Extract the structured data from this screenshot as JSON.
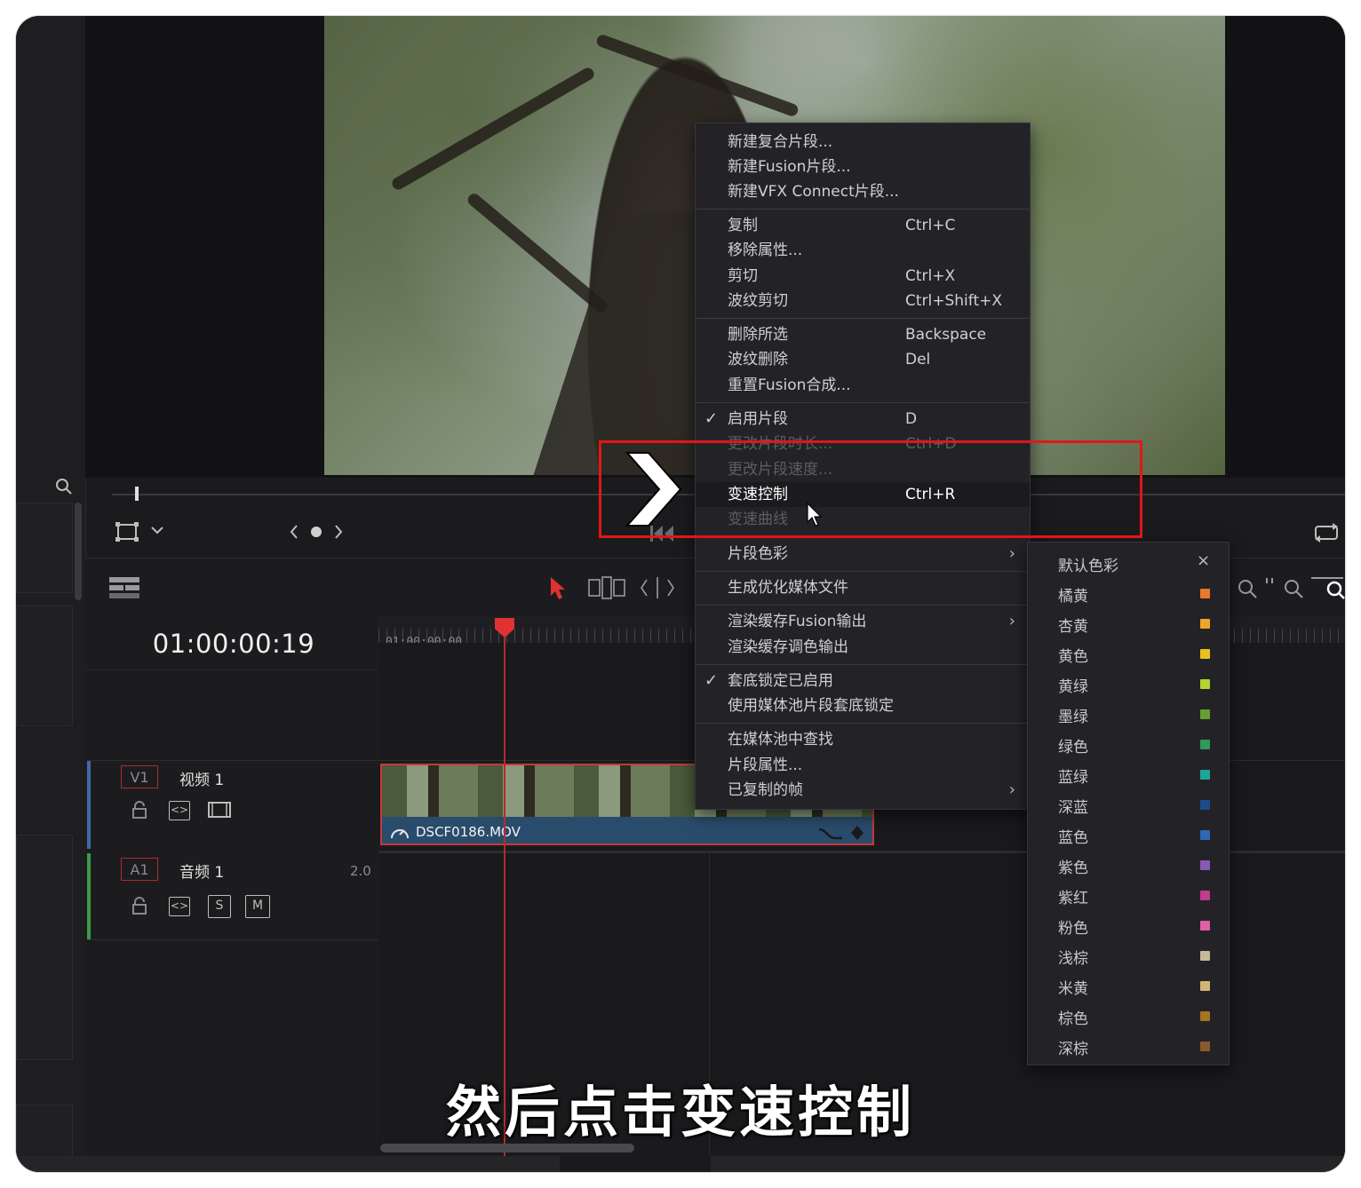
{
  "timeline": {
    "timecode": "01:00:00:19",
    "ruler_start": "01:00:00:00",
    "video_track": {
      "badge": "V1",
      "name": "视频 1"
    },
    "audio_track": {
      "badge": "A1",
      "name": "音频 1",
      "level": "2.0",
      "solo_label": "S",
      "mute_label": "M"
    },
    "clip": {
      "name": "DSCF0186.MOV"
    }
  },
  "context_menu": {
    "items": [
      {
        "label": "新建复合片段...",
        "shortcut": ""
      },
      {
        "label": "新建Fusion片段...",
        "shortcut": ""
      },
      {
        "label": "新建VFX Connect片段...",
        "shortcut": ""
      },
      {
        "label": "复制",
        "shortcut": "Ctrl+C"
      },
      {
        "label": "移除属性...",
        "shortcut": ""
      },
      {
        "label": "剪切",
        "shortcut": "Ctrl+X"
      },
      {
        "label": "波纹剪切",
        "shortcut": "Ctrl+Shift+X"
      },
      {
        "label": "删除所选",
        "shortcut": "Backspace"
      },
      {
        "label": "波纹删除",
        "shortcut": "Del"
      },
      {
        "label": "重置Fusion合成...",
        "shortcut": ""
      },
      {
        "label": "启用片段",
        "shortcut": "D",
        "checked": true
      },
      {
        "label": "更改片段时长...",
        "shortcut": "Ctrl+D"
      },
      {
        "label": "更改片段速度...",
        "shortcut": ""
      },
      {
        "label": "变速控制",
        "shortcut": "Ctrl+R",
        "highlighted": true
      },
      {
        "label": "变速曲线",
        "shortcut": ""
      },
      {
        "label": "片段色彩",
        "submenu": true
      },
      {
        "label": "生成优化媒体文件"
      },
      {
        "label": "渲染缓存Fusion输出",
        "submenu": true
      },
      {
        "label": "渲染缓存调色输出"
      },
      {
        "label": "套底锁定已启用",
        "checked": true
      },
      {
        "label": "使用媒体池片段套底锁定"
      },
      {
        "label": "在媒体池中查找"
      },
      {
        "label": "片段属性..."
      },
      {
        "label": "已复制的帧",
        "submenu": true
      }
    ]
  },
  "clip_color_menu": {
    "default_label": "默认色彩",
    "close_glyph": "×",
    "colors": [
      {
        "name": "橘黄",
        "color": "#e8782a"
      },
      {
        "name": "杏黄",
        "color": "#f0a42a"
      },
      {
        "name": "黄色",
        "color": "#e8c21e"
      },
      {
        "name": "黄绿",
        "color": "#b4d430"
      },
      {
        "name": "墨绿",
        "color": "#64a030"
      },
      {
        "name": "绿色",
        "color": "#2e9a58"
      },
      {
        "name": "蓝绿",
        "color": "#1fa49a"
      },
      {
        "name": "深蓝",
        "color": "#1e4a8c"
      },
      {
        "name": "蓝色",
        "color": "#2e6ab4"
      },
      {
        "name": "紫色",
        "color": "#8a5ab0"
      },
      {
        "name": "紫红",
        "color": "#c03c8c"
      },
      {
        "name": "粉色",
        "color": "#e060a8"
      },
      {
        "name": "浅棕",
        "color": "#c8b89a"
      },
      {
        "name": "米黄",
        "color": "#d4b47a"
      },
      {
        "name": "棕色",
        "color": "#a8741e"
      },
      {
        "name": "深棕",
        "color": "#8a5a2e"
      }
    ]
  },
  "caption": "然后点击变速控制",
  "accent": {
    "highlight_box": "#e01717",
    "playhead": "#e03232"
  }
}
